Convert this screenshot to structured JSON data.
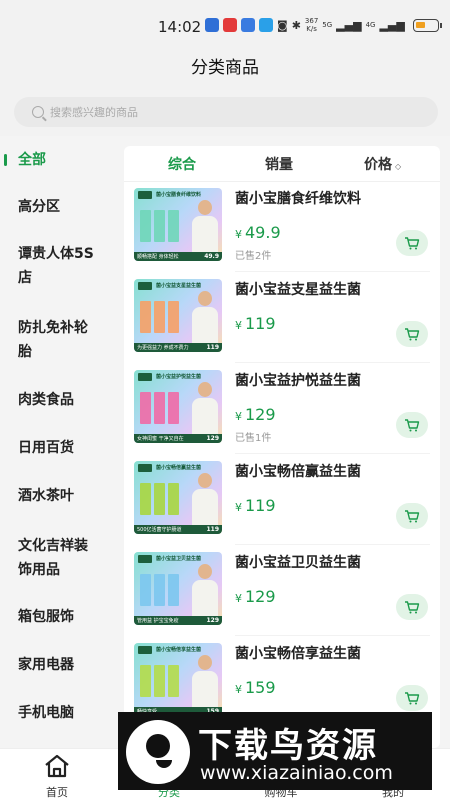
{
  "status": {
    "time": "14:02",
    "net_speed_value": "367",
    "net_speed_unit": "K/s",
    "signal_5g": "5G",
    "signal_4g": "4G"
  },
  "page": {
    "title": "分类商品"
  },
  "search": {
    "placeholder": "搜索感兴趣的商品"
  },
  "categories": [
    {
      "label": "全部",
      "active": true
    },
    {
      "label": "高分区"
    },
    {
      "label": "谭贵人体5S店"
    },
    {
      "label": "防扎免补轮胎"
    },
    {
      "label": "肉类食品"
    },
    {
      "label": "日用百货"
    },
    {
      "label": "酒水茶叶"
    },
    {
      "label": "文化吉祥装饰用品"
    },
    {
      "label": "箱包服饰"
    },
    {
      "label": "家用电器"
    },
    {
      "label": "手机电脑"
    }
  ],
  "sort": {
    "tabs": [
      {
        "label": "综合",
        "active": true
      },
      {
        "label": "销量"
      },
      {
        "label": "价格"
      }
    ]
  },
  "currency": "¥",
  "products": [
    {
      "name": "菌小宝膳食纤维饮料",
      "price": "49.9",
      "sold": "已售2件",
      "image_title": "菌小宝膳食纤维饮料",
      "image_slogan": "顺畅搭配 身体轻松",
      "image_price": "49.9",
      "box_color": "#6fd6b8"
    },
    {
      "name": "菌小宝益支星益生菌",
      "price": "119",
      "sold": "",
      "image_title": "菌小宝益支星益生菌",
      "image_slogan": "为更强益力 养成不费力",
      "image_price": "119",
      "box_color": "#f6a066"
    },
    {
      "name": "菌小宝益护悦益生菌",
      "price": "129",
      "sold": "已售1件",
      "image_title": "菌小宝益护悦益生菌",
      "image_slogan": "女神闺蜜 干净又自在",
      "image_price": "129",
      "box_color": "#f06aa6"
    },
    {
      "name": "菌小宝畅倍赢益生菌",
      "price": "119",
      "sold": "",
      "image_title": "菌小宝畅倍赢益生菌",
      "image_slogan": "500亿活菌守护肠道",
      "image_price": "119",
      "box_color": "#a8d640"
    },
    {
      "name": "菌小宝益卫贝益生菌",
      "price": "129",
      "sold": "",
      "image_title": "菌小宝益卫贝益生菌",
      "image_slogan": "管用益 护宝宝免疫",
      "image_price": "129",
      "box_color": "#7cc6ee"
    },
    {
      "name": "菌小宝畅倍享益生菌",
      "price": "159",
      "sold": "",
      "image_title": "菌小宝畅倍享益生菌",
      "image_slogan": "畅快享受",
      "image_price": "159",
      "box_color": "#b4dc4a"
    }
  ],
  "tabbar": {
    "items": [
      {
        "label": "首页"
      },
      {
        "label": "分类",
        "active": true
      },
      {
        "label": "购物车"
      },
      {
        "label": "我的"
      }
    ]
  },
  "watermark": {
    "title": "下载鸟资源",
    "url": "www.xiazainiao.com"
  },
  "colors": {
    "accent": "#1a9a4a",
    "cart_bg": "#e2f3e6"
  },
  "icons": {
    "search": "search-icon",
    "cart": "cart-icon",
    "home": "home-icon"
  }
}
